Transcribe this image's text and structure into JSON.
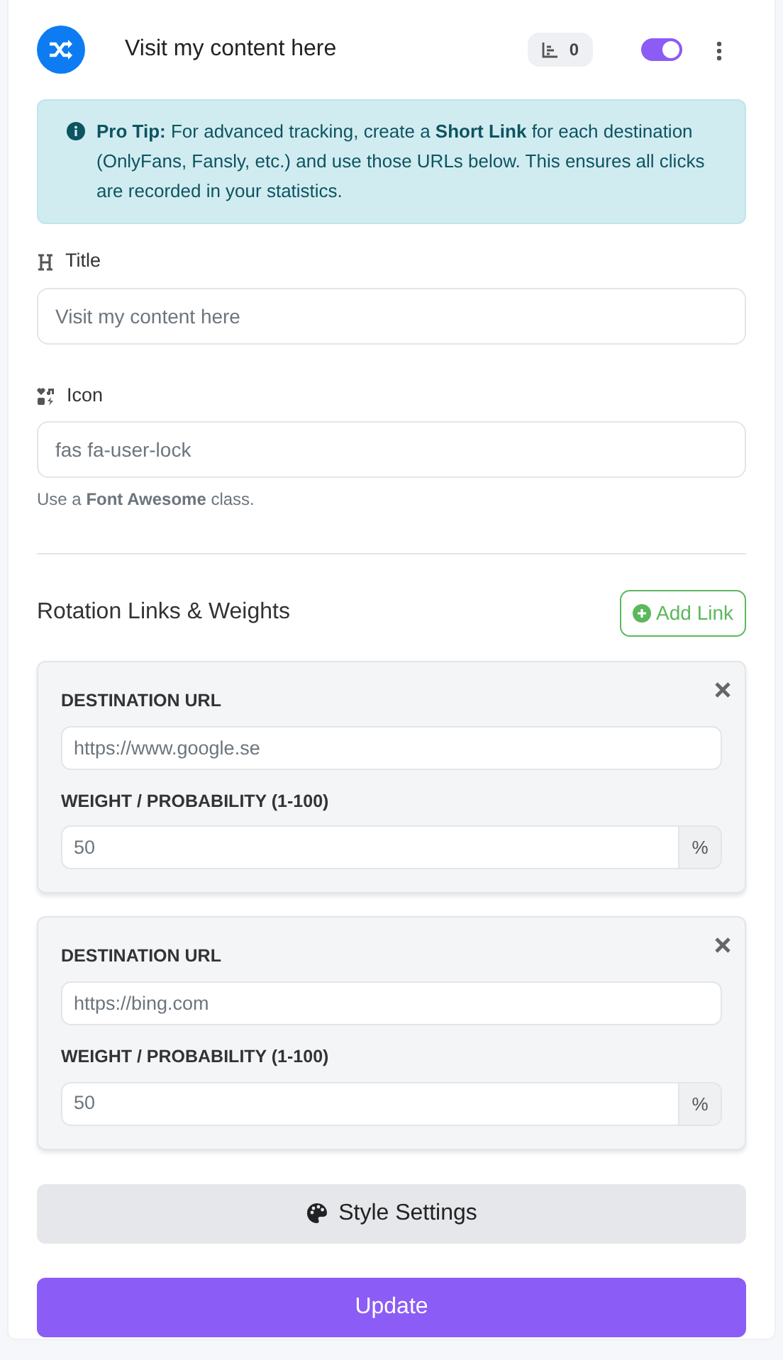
{
  "header": {
    "title": "Visit my content here",
    "clicks": "0",
    "enabled": true
  },
  "tip": {
    "text": "**Pro Tip:** For advanced tracking, create a **Short Link** for each destination (OnlyFans, Fansly, etc.) and use those URLs below. This ensures all clicks are recorded in your statistics."
  },
  "title_field": {
    "label": "Title",
    "value": "Visit my content here"
  },
  "icon_field": {
    "label": "Icon",
    "value": "fas fa-user-lock",
    "help": "Use a **Font Awesome** class."
  },
  "rotation": {
    "heading": "Rotation Links & Weights",
    "add_button": "Add Link",
    "links": [
      {
        "url_label": "DESTINATION URL",
        "url": "https://www.google.se",
        "weight_label": "WEIGHT / PROBABILITY (1-100)",
        "weight": "50",
        "unit": "%"
      },
      {
        "url_label": "DESTINATION URL",
        "url": "https://bing.com",
        "weight_label": "WEIGHT / PROBABILITY (1-100)",
        "weight": "50",
        "unit": "%"
      }
    ]
  },
  "style_button": "Style Settings",
  "submit_button": "Update"
}
